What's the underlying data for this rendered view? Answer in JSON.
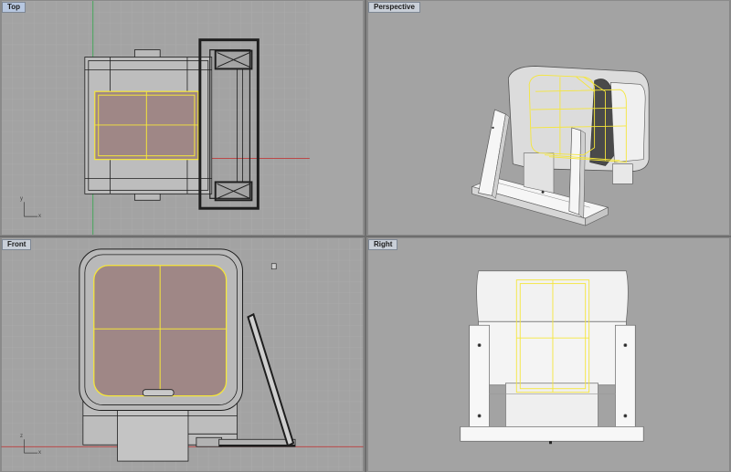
{
  "viewports": {
    "top": {
      "label": "Top"
    },
    "perspective": {
      "label": "Perspective"
    },
    "front": {
      "label": "Front"
    },
    "right": {
      "label": "Right"
    }
  },
  "axes": {
    "x": "x",
    "y": "y",
    "z": "z"
  },
  "colors": {
    "viewport_bg": "#a3a3a3",
    "grid_minor": "#b0b0b0",
    "grid_major": "#949494",
    "axis_x": "#c22a2a",
    "axis_y": "#2fa84a",
    "selection": "#f5e63a",
    "fill_selected": "#9f8786",
    "wire": "#1e1e1e",
    "solid": "#f4f4f4"
  }
}
